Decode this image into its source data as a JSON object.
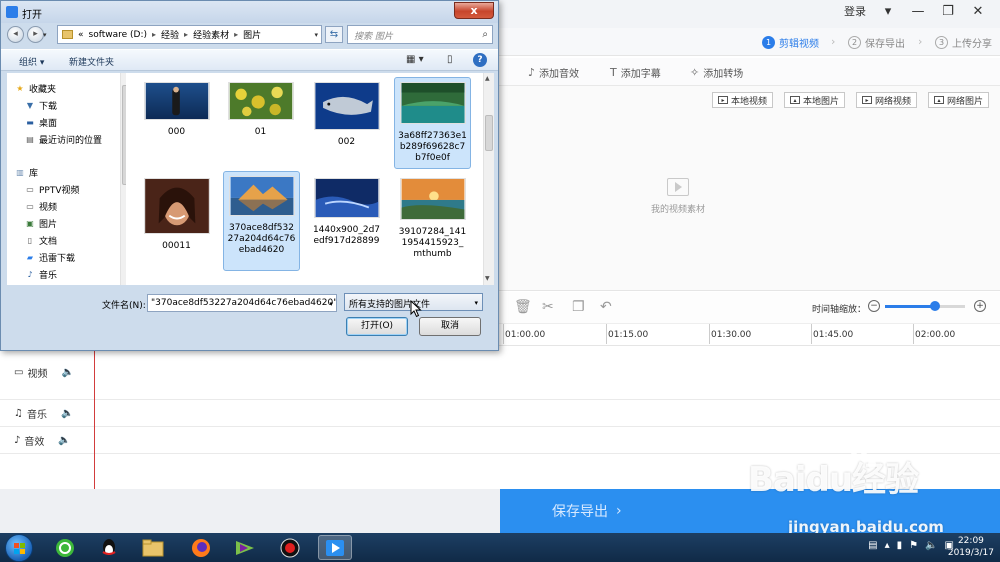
{
  "app": {
    "login": "登录",
    "steps": [
      {
        "num": "1",
        "label": "剪辑视频"
      },
      {
        "num": "2",
        "label": "保存导出"
      },
      {
        "num": "3",
        "label": "上传分享"
      }
    ],
    "toolbar": [
      "添加音效",
      "添加字幕",
      "添加转场"
    ],
    "media_buttons": [
      "本地视频",
      "本地图片",
      "网络视频",
      "网络图片"
    ],
    "empty_material": "我的视频素材",
    "zoom_label": "时间轴缩放：",
    "zoom_level": 0.62,
    "ruler_ticks": [
      "01:00.00",
      "01:15.00",
      "01:30.00",
      "01:45.00",
      "02:00.00"
    ],
    "tracks": [
      "视频",
      "音乐",
      "音效"
    ],
    "export_button": "保存导出"
  },
  "dialog": {
    "title": "打开",
    "close": "x",
    "address": {
      "chevron": "«",
      "parts": [
        "software (D:)",
        "经验",
        "经验素材",
        "图片"
      ]
    },
    "search_placeholder": "搜索 图片",
    "organize": "组织",
    "new_folder": "新建文件夹",
    "nav": [
      {
        "label": "收藏夹",
        "icon": "star-icon"
      },
      {
        "label": "下载",
        "icon": "download-icon"
      },
      {
        "label": "桌面",
        "icon": "desktop-icon"
      },
      {
        "label": "最近访问的位置",
        "icon": "recent-icon"
      },
      {
        "label": "库",
        "icon": "library-icon"
      },
      {
        "label": "PPTV视频",
        "icon": "video-icon"
      },
      {
        "label": "视频",
        "icon": "video-icon"
      },
      {
        "label": "图片",
        "icon": "picture-icon"
      },
      {
        "label": "文档",
        "icon": "document-icon"
      },
      {
        "label": "迅雷下载",
        "icon": "thunder-icon"
      },
      {
        "label": "音乐",
        "icon": "music-icon"
      }
    ],
    "files": [
      {
        "name": "000",
        "selected": false
      },
      {
        "name": "01",
        "selected": false
      },
      {
        "name": "002",
        "selected": false
      },
      {
        "name": "3a68ff27363e1b289f69628c7b7f0e0f",
        "selected": true
      },
      {
        "name": "00011",
        "selected": false
      },
      {
        "name": "370ace8df53227a204d64c76ebad4620",
        "selected": true
      },
      {
        "name": "1440x900_2d7edf917d28899",
        "selected": false
      },
      {
        "name": "39107284_1411954415923_mthumb",
        "selected": false
      }
    ],
    "filename_label": "文件名(N):",
    "filename_value": "\"370ace8df53227a204d64c76ebad4620\"",
    "filter": "所有支持的图片文件",
    "open": "打开(O)",
    "cancel": "取消"
  },
  "taskbar": {
    "time": "22:09",
    "date": "2019/3/17"
  },
  "watermark": {
    "brand": "Baidu经验",
    "url": "jingyan.baidu.com"
  },
  "colors": {
    "accent": "#2b7de9",
    "export_bg": "#2b8ff0",
    "selection": "#cce4fb"
  }
}
